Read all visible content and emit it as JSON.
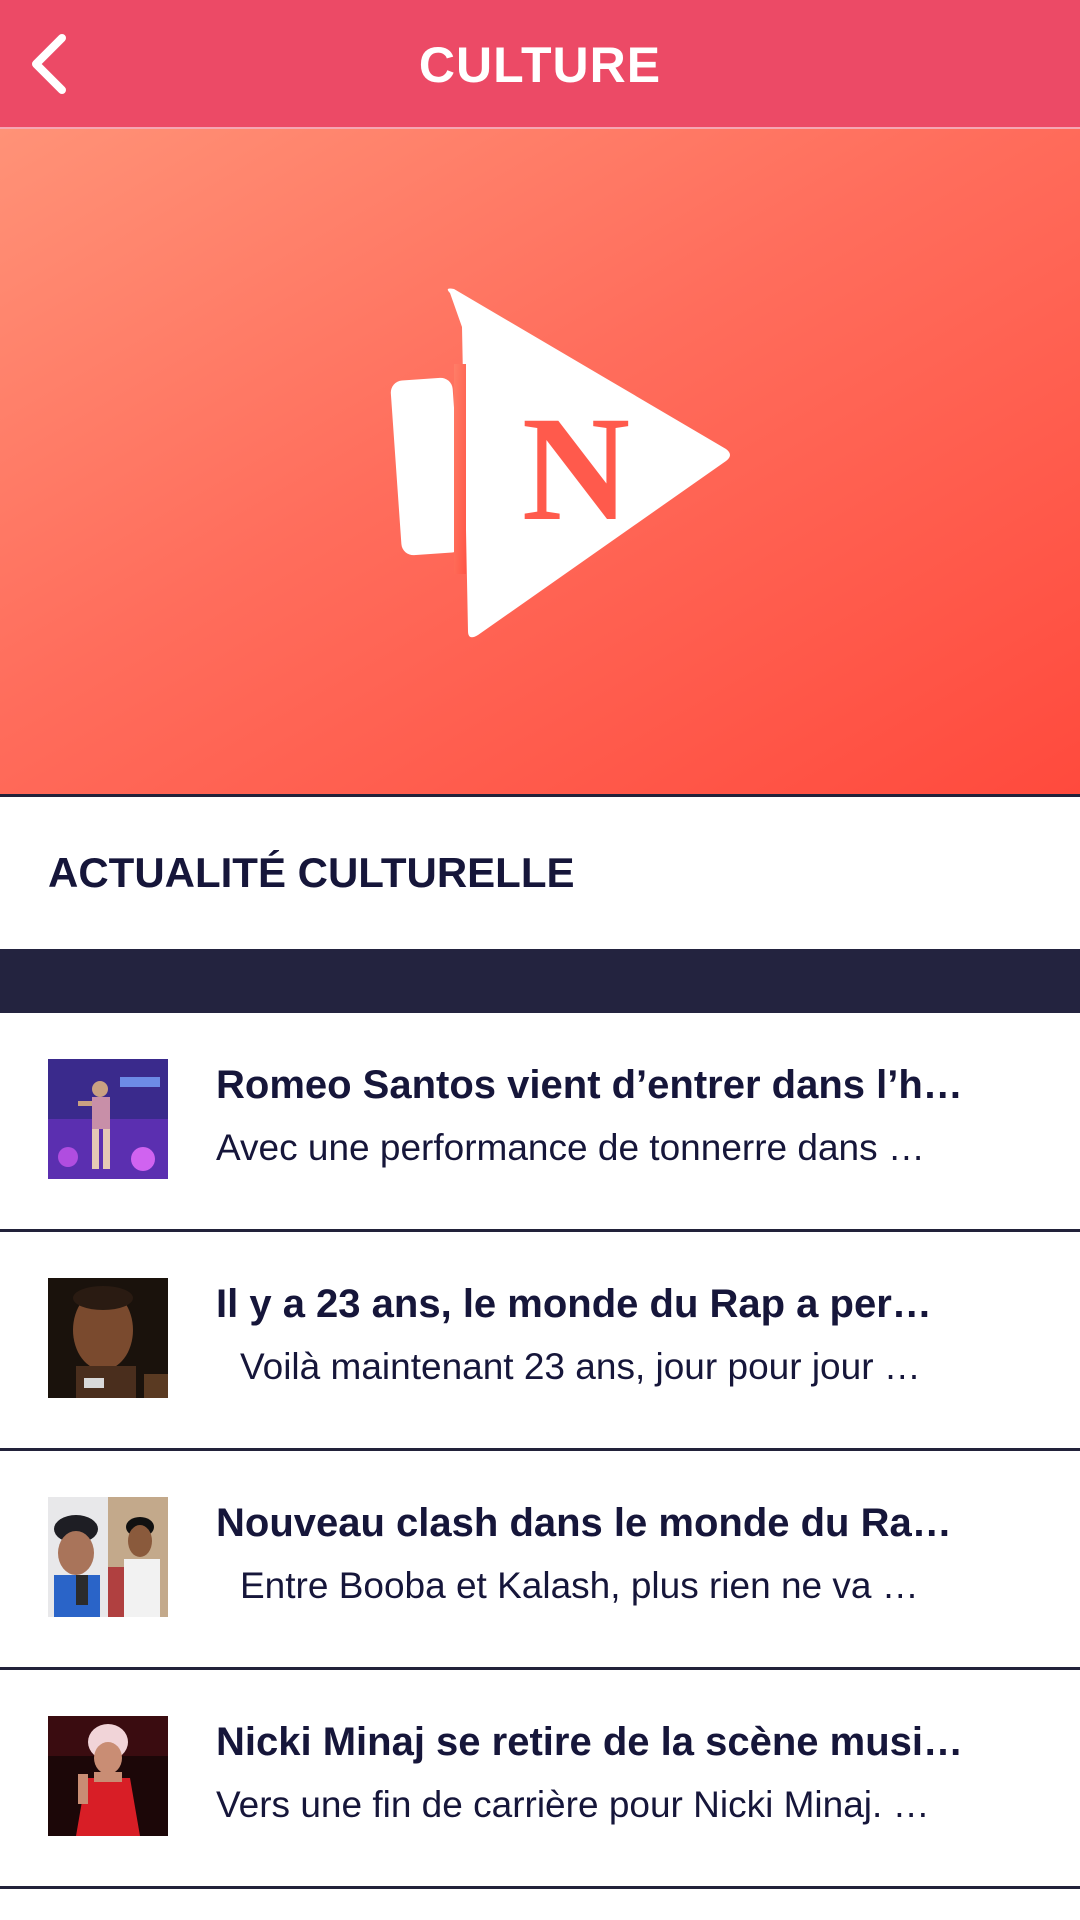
{
  "header": {
    "title": "CULTURE",
    "back_icon": "chevron-left-icon",
    "background": "#ec4a66"
  },
  "hero": {
    "logo_icon": "play-megaphone-n-logo-icon",
    "logo_letter": "N",
    "gradient_start": "#ff9277",
    "gradient_end": "#ff4a3d"
  },
  "section": {
    "title": "ACTUALITÉ CULTURELLE"
  },
  "articles": [
    {
      "title": "Romeo Santos vient d’entrer dans l’h…",
      "subtitle": "Avec une performance de tonnerre dans …"
    },
    {
      "title": "Il y a 23 ans, le monde du Rap a per…",
      "subtitle": "Voilà maintenant 23 ans, jour pour jour …"
    },
    {
      "title": "Nouveau clash dans le monde du Ra…",
      "subtitle": "Entre Booba et Kalash, plus rien ne va …"
    },
    {
      "title": "Nicki Minaj se retire de la scène musi…",
      "subtitle": "Vers une fin de carrière pour Nicki Minaj. …"
    }
  ],
  "colors": {
    "dark_bar": "#23233f",
    "text": "#16163a"
  }
}
